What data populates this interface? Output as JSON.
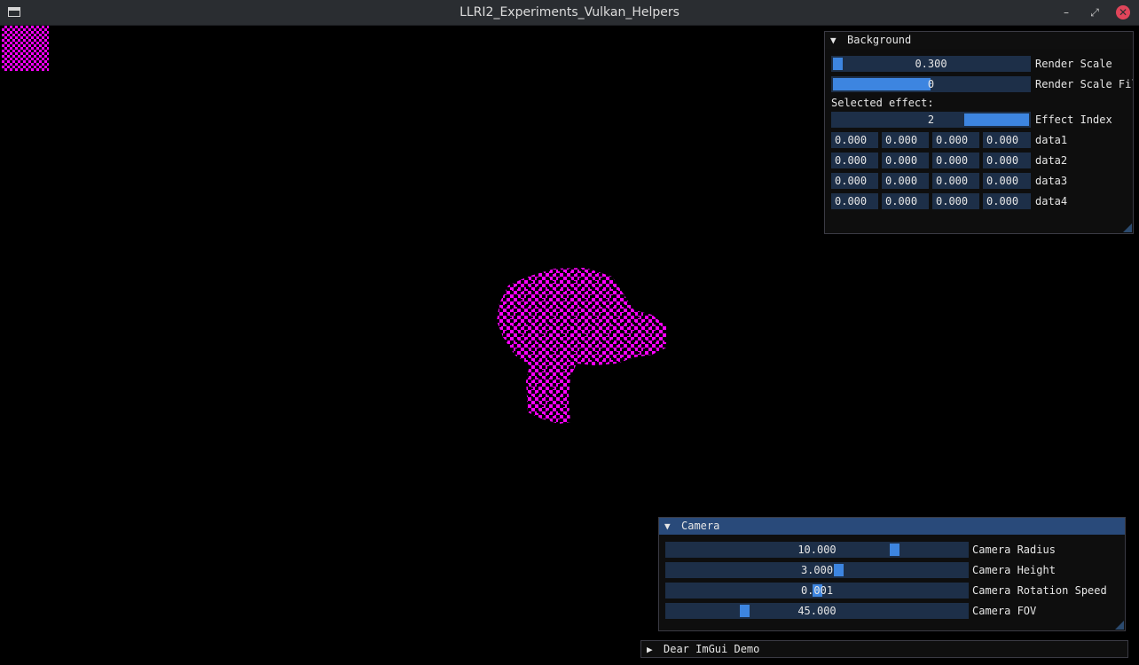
{
  "window": {
    "title": "LLRI2_Experiments_Vulkan_Helpers",
    "buttons": {
      "minimize": "–",
      "maximize": "⤢",
      "close": "✕"
    }
  },
  "colors": {
    "model": "#ff00ff",
    "frame_bg": "#1d2f48",
    "grab": "#3d85e0",
    "title_active": "#294a7a",
    "title_bg": "#0f0f0f"
  },
  "background_panel": {
    "title": "Background",
    "arrow": "▼",
    "render_scale": {
      "value": "0.300",
      "label": "Render Scale",
      "fraction": 0.03
    },
    "render_scale_filter": {
      "value": "0",
      "label": "Render Scale Fil"
    },
    "selected_effect_text": "Selected effect:",
    "effect_index": {
      "value": "2",
      "label": "Effect Index"
    },
    "data_rows": [
      {
        "label": "data1",
        "values": [
          "0.000",
          "0.000",
          "0.000",
          "0.000"
        ]
      },
      {
        "label": "data2",
        "values": [
          "0.000",
          "0.000",
          "0.000",
          "0.000"
        ]
      },
      {
        "label": "data3",
        "values": [
          "0.000",
          "0.000",
          "0.000",
          "0.000"
        ]
      },
      {
        "label": "data4",
        "values": [
          "0.000",
          "0.000",
          "0.000",
          "0.000"
        ]
      }
    ]
  },
  "camera_panel": {
    "title": "Camera",
    "arrow": "▼",
    "sliders": [
      {
        "value": "10.000",
        "label": "Camera Radius"
      },
      {
        "value": "3.000",
        "label": "Camera Height"
      },
      {
        "value": "0.001",
        "label": "Camera Rotation Speed"
      },
      {
        "value": "45.000",
        "label": "Camera FOV"
      }
    ]
  },
  "demo_panel": {
    "title": "Dear ImGui Demo",
    "arrow": "▶"
  }
}
